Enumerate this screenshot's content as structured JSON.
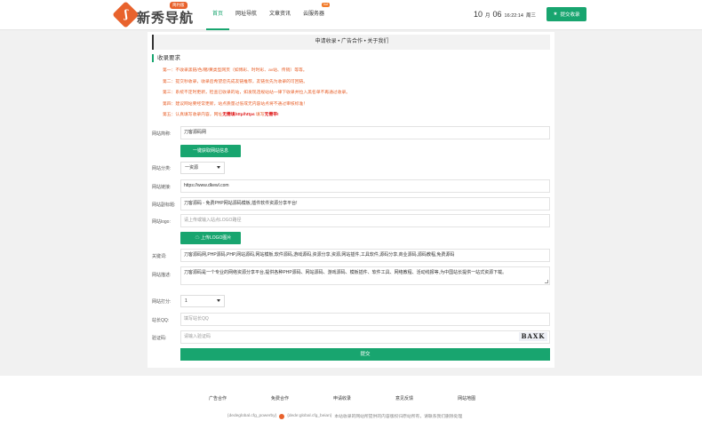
{
  "header": {
    "logo_text": "新秀导航",
    "logo_badge": "简约版",
    "nav": [
      {
        "label": "首页",
        "active": true
      },
      {
        "label": "网址导航"
      },
      {
        "label": "文章资讯"
      },
      {
        "label": "云服务器",
        "badge": "hot"
      }
    ],
    "clock": {
      "month": "10",
      "month_unit": "月",
      "day": "06",
      "time": "16:22:14",
      "weekday": "周三"
    },
    "submit_site_label": "提交收录"
  },
  "panel": {
    "tabs_text": "申请收录 • 广告合作 • 关于我们",
    "section_title": "收录要求",
    "requirements": [
      {
        "prefix": "第一：",
        "text": "不收录黑链/色/赌/黄类型网页（如博彩、时时彩、av站、传销）等等。"
      },
      {
        "prefix": "第二：",
        "text": "提交秒收录，收录后希望您先成友链推荐，友链优先为收录的可回链。"
      },
      {
        "prefix": "第三：",
        "text": "系统不定时更新，检查已收录的站，如发现违规站站一律下收录并拉入黑名单不再通过收录。"
      },
      {
        "prefix": "第四：",
        "text": "建议网站要经常更新，站点质量过低或无内容站点将不通过审核标准！"
      },
      {
        "prefix": "第五：",
        "text": "认真填写收录内容，网址",
        "em": "无需填http/https",
        "suffix": " 填写",
        "em2": "无需带!"
      }
    ],
    "form": {
      "site_name": {
        "label": "网站简称:",
        "value": "刀客源码网"
      },
      "fetch_button": "一键获取网站信息",
      "category": {
        "label": "网站分类:",
        "value": "一资源"
      },
      "site_url": {
        "label": "网站链接:",
        "value": "https://www.dkewl.com"
      },
      "subtitle": {
        "label": "网站副标题:",
        "value": "刀客源码 - 免费PHP网站源码模板,插件软件资源分享平台!"
      },
      "logo": {
        "label": "网站logo:",
        "placeholder": "请上传或输入站点LOGO路径"
      },
      "upload_button": "上传LOGO图片",
      "keywords": {
        "label": "关键词:",
        "value": "刀客源码网,PHP源码,PHP,网站源码,网站模板,软件源码,游戏源码,资源分享,资源,网站插件,工具软件,源码分享,商业源码,源码教程,免费源码"
      },
      "description": {
        "label": "网站描述:",
        "value": "刀客源码是一个专业的网络资源分享平台,提供各种PHP源码、网站源码、游戏源码、模板插件、软件工具、网络教程、活动线报等,为中国站长提供一站式资源下载。"
      },
      "rating": {
        "label": "网站打分:",
        "value": "1"
      },
      "qq": {
        "label": "站长QQ:",
        "placeholder": "填写站长QQ"
      },
      "captcha": {
        "label": "验证码:",
        "placeholder": "请输入验证码",
        "image_text": "BAXK"
      },
      "submit_label": "提交"
    }
  },
  "footer": {
    "links": [
      "广告合作",
      "免费合作",
      "申请收录",
      "意见反馈",
      "网站地图"
    ],
    "bottom_left": "{dedeglobal.cfg_powerby}",
    "bottom_mid": "{dede:global.cfg_beian}",
    "bottom_right": "本站收录的网站所提供的内容版权归原站所有，请联系我们删除处理"
  },
  "colors": {
    "accent": "#18a56f",
    "warning": "#e8622c",
    "emphasis": "#e02020"
  }
}
